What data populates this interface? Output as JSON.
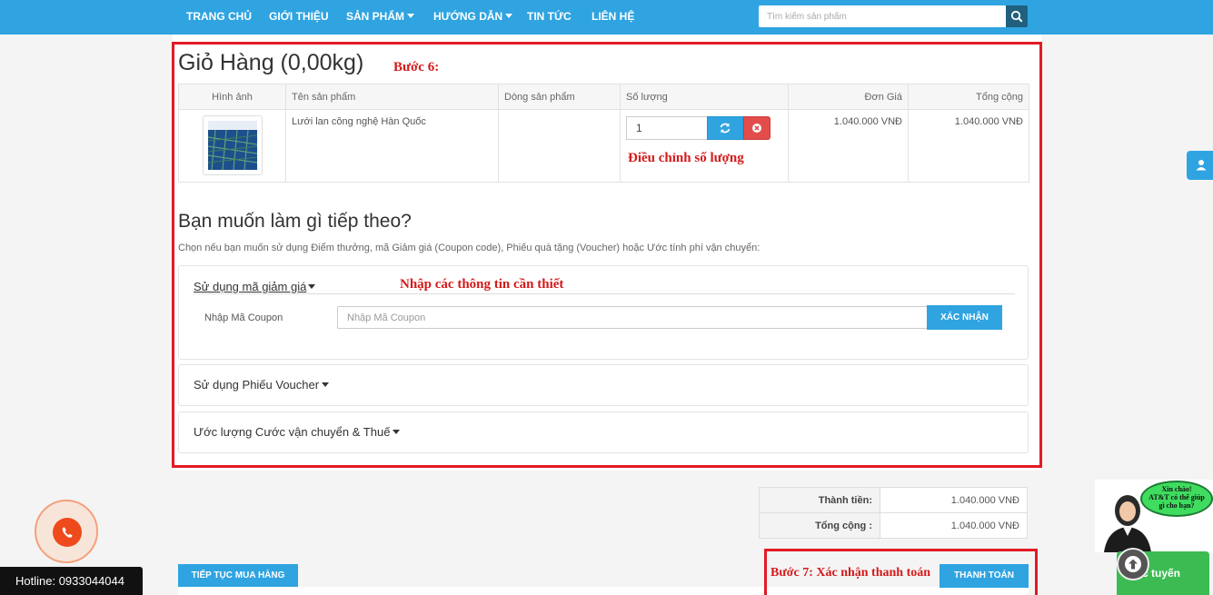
{
  "nav": {
    "items": [
      {
        "label": "TRANG CHỦ"
      },
      {
        "label": "GIỚI THIỆU"
      },
      {
        "label": "SẢN PHẨM"
      },
      {
        "label": "HƯỚNG DẪN"
      },
      {
        "label": "TIN TỨC"
      },
      {
        "label": "LIÊN HỆ"
      }
    ],
    "search_placeholder": "Tìm kiếm sản phẩm"
  },
  "cart": {
    "title": "Giỏ Hàng  (0,00kg)",
    "columns": [
      "Hình ảnh",
      "Tên sản phẩm",
      "Dòng sản phẩm",
      "Số lượng",
      "Đơn Giá",
      "Tổng cộng"
    ],
    "rows": [
      {
        "name": "Lưới lan công nghệ Hàn Quốc",
        "model": "",
        "quantity": "1",
        "unit_price": "1.040.000 VNĐ",
        "total": "1.040.000 VNĐ"
      }
    ]
  },
  "annotations": {
    "step6": "Bước 6:",
    "adjust_qty": "Điều chỉnh số lượng",
    "enter_info": "Nhập các thông tin cần thiết",
    "step7": "Bước 7: Xác nhận thanh toán"
  },
  "next": {
    "title": "Bạn muốn làm gì tiếp theo?",
    "desc": "Chọn nếu bạn muốn sử dụng Điểm thưởng, mã Giảm giá (Coupon code), Phiếu quà tặng (Voucher) hoặc Ước tính phí vận chuyển:",
    "coupon_head": "Sử dụng mã giảm giá",
    "coupon_label": "Nhập Mã Coupon",
    "coupon_placeholder": "Nhập Mã Coupon",
    "coupon_button": "XÁC NHẬN",
    "voucher_head": "Sử dụng Phiếu Voucher",
    "shipping_head": "Ước lượng Cước vận chuyển & Thuế"
  },
  "totals": {
    "rows": [
      {
        "label": "Thành tiền:",
        "value": "1.040.000 VNĐ"
      },
      {
        "label": "Tổng cộng :",
        "value": "1.040.000 VNĐ"
      }
    ]
  },
  "actions": {
    "continue": "TIẾP TỤC MUA HÀNG",
    "checkout": "THANH TOÁN"
  },
  "widgets": {
    "hotline": "Hotline: 0933044044",
    "chat_bubble": [
      "Xin chào!",
      "AT&T có thể giúp",
      "gì cho bạn?"
    ],
    "chat_bar": "c tuyến"
  },
  "colors": {
    "primary": "#2fa4e1",
    "annotation_red": "#e21b24",
    "danger": "#e24c4b",
    "chat_green": "#3cbb53"
  }
}
